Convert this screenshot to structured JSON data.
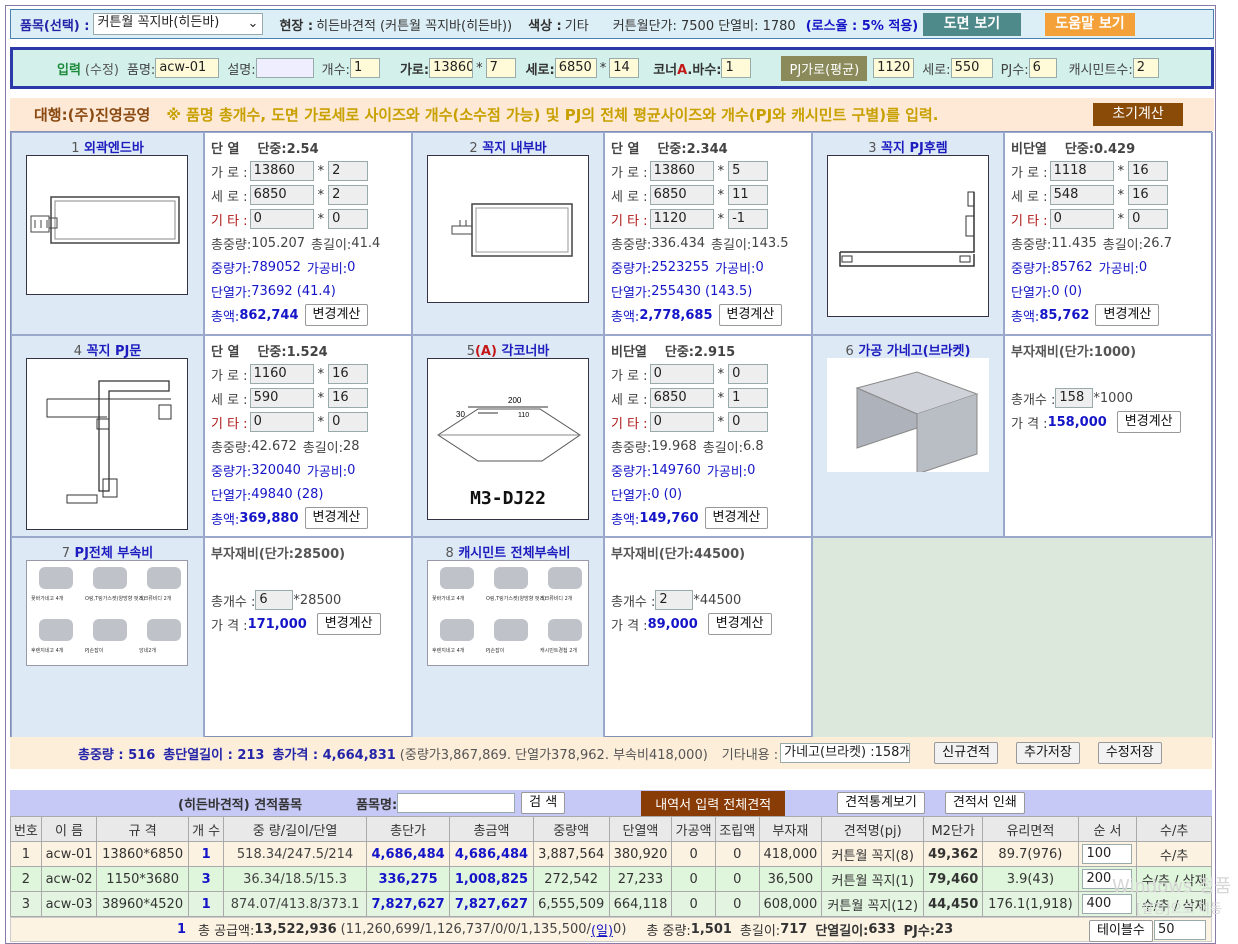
{
  "top": {
    "item_label": "품목(선택) :",
    "item_value": "커튼월 꼭지바(히든바)",
    "site_label": "현장 :",
    "site_value": "히든바견적 (커튼월 꼭지바(히든바))",
    "color_label": "색상 :",
    "color_value": "기타",
    "unit_price_text": "커튼월단가: 7500 단열비: 1780",
    "loss_text": "(로스율 : 5% 적용)",
    "drawing_btn": "도면 보기",
    "help_btn": "도움말 보기"
  },
  "input": {
    "label": "입력",
    "sub": "(수정)",
    "name_label": "품명:",
    "name_value": "acw-01",
    "desc_label": "설명:",
    "desc_value": "",
    "count_label": "개수:",
    "count_value": "1",
    "w_label": "가로:",
    "w_value": "13860",
    "w_mult": "7",
    "h_label": "세로:",
    "h_value": "6850",
    "h_mult": "14",
    "corner_label_a": "코너",
    "corner_label_b": "A",
    "corner_label_c": ".바수:",
    "corner_value": "1",
    "pj_btn": "PJ가로(평균)",
    "pj_w": "1120",
    "pj_h_label": "세로:",
    "pj_h": "550",
    "pj_n_label": "PJ수:",
    "pj_n": "6",
    "cm_label": "캐시민트수:",
    "cm_value": "2"
  },
  "notice": {
    "agent": "대행:(주)진영공영",
    "text": "※ 품명 총개수, 도면 가로세로 사이즈와 개수(소수점 가능) 및 PJ의 전체 평균사이즈와 개수(PJ와 캐시민트 구별)를 입력.",
    "reset_btn": "초기계산"
  },
  "lbl": {
    "w": "가 로 :",
    "h": "세 로 :",
    "etc": "기 타 :",
    "wt": "총중량:",
    "len": "총길이:",
    "mid": "중량가:",
    "proc": "가공비:",
    "unit": "단열가:",
    "amt": "총액:",
    "calc": "변경계산",
    "qty": "총개수 :",
    "price": "가 격 :",
    "mult": "*"
  },
  "parts": [
    {
      "num": "1",
      "name": "외곽엔드바",
      "type": "단 열",
      "unit": "단중:2.54",
      "w": "13860",
      "wm": "2",
      "h": "6850",
      "hm": "2",
      "e": "0",
      "em": "0",
      "wt": "105.207",
      "len": "41.4",
      "mid": "789052",
      "proc": "0",
      "unitp": "73692 (41.4)",
      "amt": "862,744"
    },
    {
      "num": "2",
      "name": "꼭지 내부바",
      "type": "단 열",
      "unit": "단중:2.344",
      "w": "13860",
      "wm": "5",
      "h": "6850",
      "hm": "11",
      "e": "1120",
      "em": "-1",
      "wt": "336.434",
      "len": "143.5",
      "mid": "2523255",
      "proc": "0",
      "unitp": "255430 (143.5)",
      "amt": "2,778,685"
    },
    {
      "num": "3",
      "name": "꼭지 PJ후렘",
      "type": "비단열",
      "unit": "단중:0.429",
      "w": "1118",
      "wm": "16",
      "h": "548",
      "hm": "16",
      "e": "0",
      "em": "0",
      "wt": "11.435",
      "len": "26.7",
      "mid": "85762",
      "proc": "0",
      "unitp": "0 (0)",
      "amt": "85,762"
    },
    {
      "num": "4",
      "name": "꼭지 PJ문",
      "type": "단 열",
      "unit": "단중:1.524",
      "w": "1160",
      "wm": "16",
      "h": "590",
      "hm": "16",
      "e": "0",
      "em": "0",
      "wt": "42.672",
      "len": "28",
      "mid": "320040",
      "proc": "0",
      "unitp": "49840 (28)",
      "amt": "369,880"
    },
    {
      "num": "5",
      "name": "각코너바",
      "tag": "(A)",
      "type": "비단열",
      "unit": "단중:2.915",
      "w": "0",
      "wm": "0",
      "h": "6850",
      "hm": "1",
      "e": "0",
      "em": "0",
      "wt": "19.968",
      "len": "6.8",
      "mid": "149760",
      "proc": "0",
      "unitp": "0 (0)",
      "amt": "149,760",
      "img_text": "M3-DJ22",
      "dim_a": "200",
      "dim_b": "30",
      "dim_c": "110"
    }
  ],
  "sub_parts": [
    {
      "num": "6",
      "name": "가공 가네고(브라켓)",
      "head": "부자재비(단가:1000)",
      "qty": "158",
      "mult": "*1000",
      "price": "158,000"
    },
    {
      "num": "7",
      "name": "PJ전체 부속비",
      "head": "부자재비(단가:28500)",
      "qty": "6",
      "mult": "*28500",
      "price": "171,000",
      "labels": [
        "꽃바가네고 4개",
        "O링,T링가스켓(양방향 펏게)",
        "스크류비디 2개",
        "후렌지네고 4개",
        "PJ손잡이",
        "앙네2개"
      ]
    },
    {
      "num": "8",
      "name": "캐시민트 전체부속비",
      "head": "부자재비(단가:44500)",
      "qty": "2",
      "mult": "*44500",
      "price": "89,000",
      "labels": [
        "꽃바가네고 4개",
        "O링,T링가스켓(양방향 펏게)",
        "스크류비디 2개",
        "후렌지네고 4개",
        "PJ손잡이",
        "캐시민트경첩 2개"
      ]
    }
  ],
  "summary": {
    "wt": "총중량 : 516",
    "len": "총단열길이 : 213",
    "price": "총가격 : 4,664,831",
    "detail": "(중량가3,867,869.  단열가378,962.  부속비418,000)",
    "etc_label": "기타내용 :",
    "etc_value": "가네고(브라켓) :158개",
    "new_btn": "신규견적",
    "add_btn": "추가저장",
    "mod_btn": "수정저장"
  },
  "list_bar": {
    "title": "(히든바견적)  견적품목",
    "name_label": "품목명:",
    "search_btn": "검 색",
    "all_btn": "내역서 입력 전체견적",
    "stat_btn": "견적통계보기",
    "print_btn": "견적서 인쇄"
  },
  "table": {
    "headers": [
      "번호",
      "이 름",
      "규 격",
      "개 수",
      "중 량/길이/단열",
      "총단가",
      "총금액",
      "중량액",
      "단열액",
      "가공액",
      "조립액",
      "부자재",
      "견적명(pj)",
      "M2단가",
      "유리면적",
      "순 서",
      "수/추"
    ],
    "rows": [
      [
        "1",
        "acw-01",
        "13860*6850",
        "1",
        "518.34/247.5/214",
        "4,686,484",
        "4,686,484",
        "3,887,564",
        "380,920",
        "0",
        "0",
        "418,000",
        "커튼월 꼭지(8)",
        "49,362",
        "89.7(976)",
        "100",
        "수/추"
      ],
      [
        "2",
        "acw-02",
        "1150*3680",
        "3",
        "36.34/18.5/15.3",
        "336,275",
        "1,008,825",
        "272,542",
        "27,233",
        "0",
        "0",
        "36,500",
        "커튼월 꼭지(1)",
        "79,460",
        "3.9(43)",
        "200",
        "수/추 / 삭제"
      ],
      [
        "3",
        "acw-03",
        "38960*4520",
        "1",
        "874.07/413.8/373.1",
        "7,827,627",
        "7,827,627",
        "6,555,509",
        "664,118",
        "0",
        "0",
        "608,000",
        "커튼월 꼭지(12)",
        "44,450",
        "176.1(1,918)",
        "400",
        "수/추 / 삭제"
      ]
    ]
  },
  "total": {
    "num": "1",
    "supply_label": "총 공급액:",
    "supply": "13,522,936",
    "detail": "(11,260,699/1,126,737/0/0/1,135,500/",
    "link": "(일)",
    "close": "0)",
    "wt_label": "총 중량:",
    "wt": "1,501",
    "len_label": "총길이:",
    "len": "717",
    "ins_label": "단열길이:",
    "ins": "633",
    "pj_label": "PJ수:",
    "pj": "23",
    "table_btn": "테이블수",
    "table_value": "50"
  },
  "watermark": {
    "line1": "Windows 정품",
    "line2": "[설정]으로 이동"
  }
}
